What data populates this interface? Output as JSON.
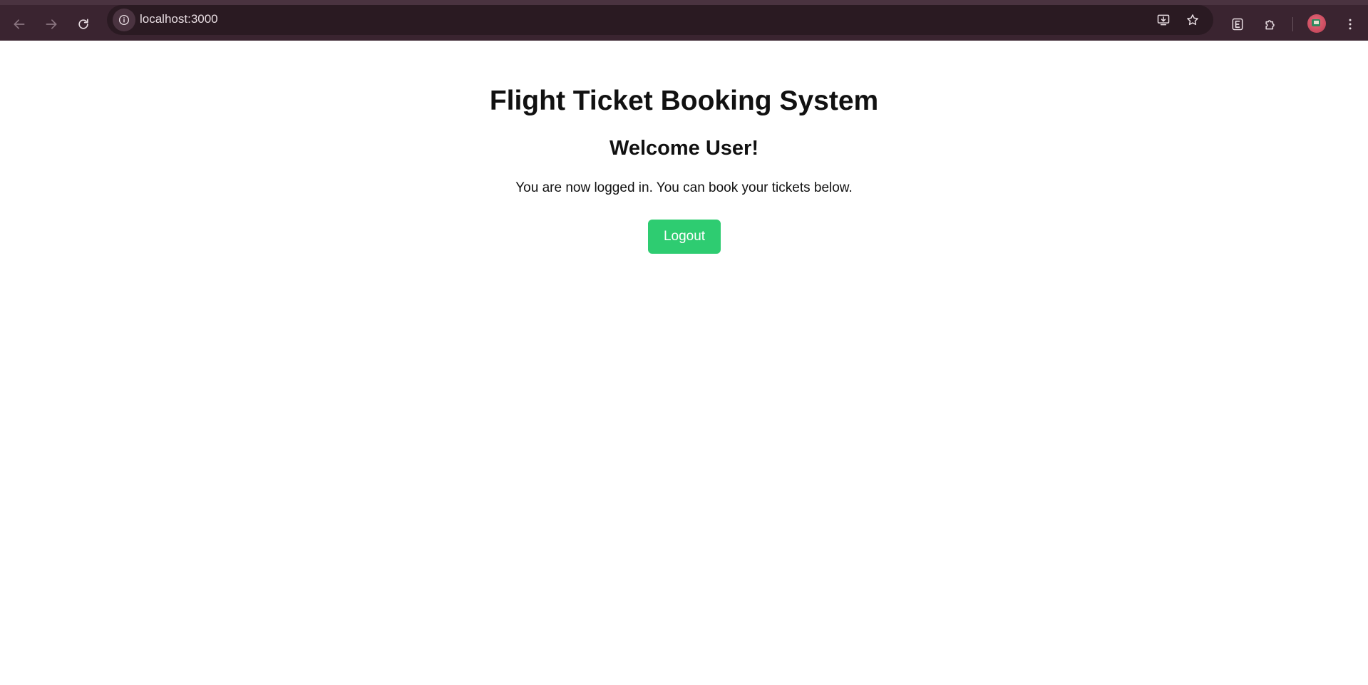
{
  "browser": {
    "url": "localhost:3000",
    "toolbar_color": "#3a2430",
    "icons": [
      "back-arrow-icon",
      "forward-arrow-icon",
      "reload-icon",
      "site-info-icon",
      "install-app-icon",
      "bookmark-star-icon",
      "extension-e-icon",
      "extensions-puzzle-icon",
      "profile-avatar",
      "kebab-menu-icon"
    ]
  },
  "page": {
    "title": "Flight Ticket Booking System",
    "welcome": "Welcome User!",
    "message": "You are now logged in. You can book your tickets below.",
    "logout_label": "Logout",
    "accent_color": "#2ecc71"
  }
}
